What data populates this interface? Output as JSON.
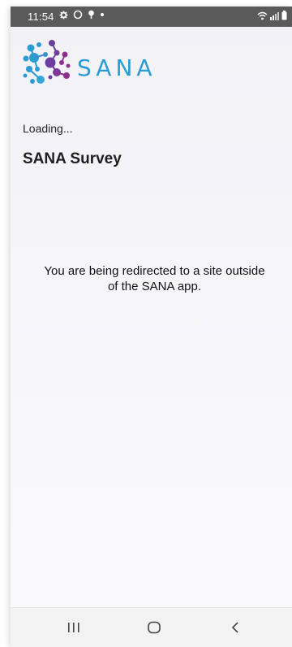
{
  "status_bar": {
    "time": "11:54",
    "left_icons": [
      "settings-icon",
      "circle-icon",
      "pin-icon",
      "dot-icon"
    ],
    "right_icons": [
      "wifi-icon",
      "signal-icon",
      "battery-icon"
    ]
  },
  "header": {
    "brand": "SANA",
    "logo_colors": [
      "#2b9bd3",
      "#6a3fa0",
      "#8e2f8a"
    ]
  },
  "content": {
    "loading": "Loading...",
    "title": "SANA Survey",
    "message": "You are being redirected to a site outside of the SANA app."
  },
  "nav_bar": {
    "buttons": [
      "recent-apps-icon",
      "home-icon",
      "back-icon"
    ]
  }
}
